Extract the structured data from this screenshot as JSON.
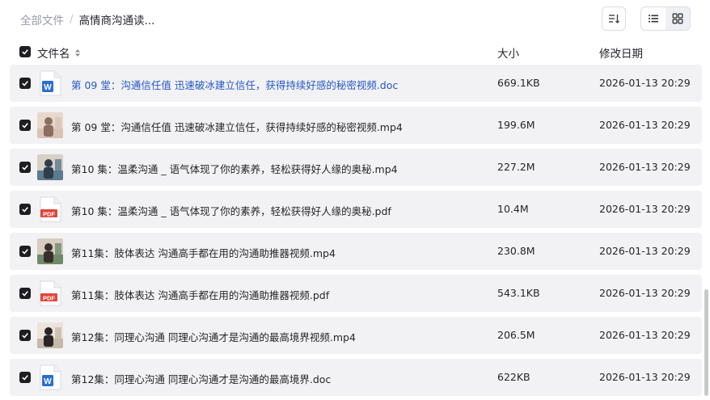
{
  "breadcrumb": {
    "root": "全部文件",
    "separator": "/",
    "current": "高情商沟通读..."
  },
  "toolbar": {
    "sort_icon": "sort-icon",
    "view_list_icon": "list-view-icon",
    "view_grid_icon": "grid-view-icon",
    "active_view": "list"
  },
  "columns": {
    "name": "文件名",
    "size": "大小",
    "date": "修改日期"
  },
  "files": [
    {
      "name": "第 09 堂：沟通信任值 迅速破冰建立信任，获得持续好感的秘密视频.doc",
      "size": "669.1KB",
      "date": "2026-01-13 20:29",
      "type": "word"
    },
    {
      "name": "第 09 堂：沟通信任值 迅速破冰建立信任，获得持续好感的秘密视频.mp4",
      "size": "199.6M",
      "date": "2026-01-13 20:29",
      "type": "video"
    },
    {
      "name": "第10 集：温柔沟通 _ 语气体现了你的素养，轻松获得好人缘的奥秘.mp4",
      "size": "227.2M",
      "date": "2026-01-13 20:29",
      "type": "video"
    },
    {
      "name": "第10 集：温柔沟通 _ 语气体现了你的素养，轻松获得好人缘的奥秘.pdf",
      "size": "10.4M",
      "date": "2026-01-13 20:29",
      "type": "pdf"
    },
    {
      "name": "第11集：肢体表达 沟通高手都在用的沟通助推器视频.mp4",
      "size": "230.8M",
      "date": "2026-01-13 20:29",
      "type": "video"
    },
    {
      "name": "第11集：肢体表达 沟通高手都在用的沟通助推器视频.pdf",
      "size": "543.1KB",
      "date": "2026-01-13 20:29",
      "type": "pdf"
    },
    {
      "name": "第12集：同理心沟通 同理心沟通才是沟通的最高境界视频.mp4",
      "size": "206.5M",
      "date": "2026-01-13 20:29",
      "type": "video"
    },
    {
      "name": "第12集：同理心沟通 同理心沟通才是沟通的最高境界.doc",
      "size": "622KB",
      "date": "2026-01-13 20:29",
      "type": "word"
    }
  ],
  "icons": {
    "word_label": "W",
    "pdf_label": "PDF"
  },
  "colors": {
    "link": "#2457c5",
    "word": "#2b6fd6",
    "pdf": "#e0463c",
    "checkbox": "#1d1e22"
  }
}
